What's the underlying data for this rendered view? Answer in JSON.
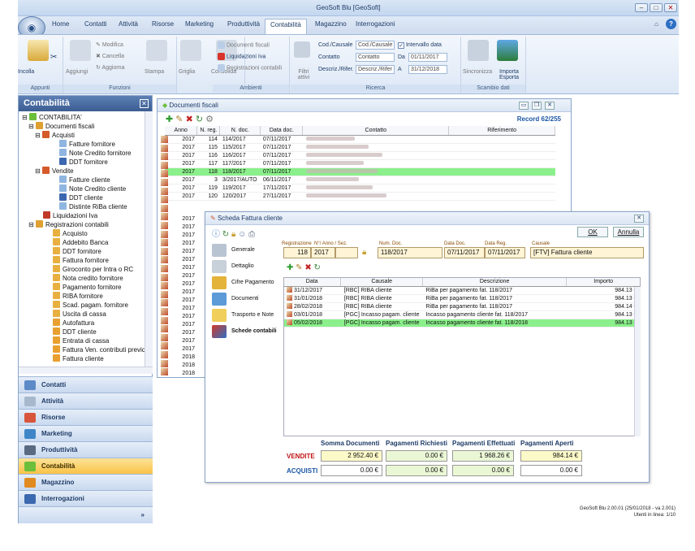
{
  "window": {
    "title": "GeoSoft Blu [GeoSoft]"
  },
  "ribbon": {
    "tabs": [
      "Home",
      "Contatti",
      "Attività",
      "Risorse",
      "Marketing",
      "Produttività",
      "Contabilità",
      "Magazzino",
      "Interrogazioni"
    ],
    "active_tab": "Contabilità",
    "groups": [
      "Appunti",
      "Funzioni",
      "Ambienti",
      "Ricerca",
      "Scambio dati"
    ],
    "buttons": {
      "incolla": "Incolla",
      "aggiungi": "Aggiungi",
      "modifica": "Modifica",
      "cancella": "Cancella",
      "aggiorna": "Aggiorna",
      "stampa": "Stampa",
      "griglia": "Griglia",
      "consolida": "Consolida",
      "documenti_fiscali": "Documenti fiscali",
      "liquidazioni_iva": "Liquidazioni Iva",
      "registrazioni_contabili": "Registrazioni contabili",
      "filtri_attivi": "Filtri attivi",
      "sincronizza": "Sincronizza",
      "importa_esporta": "Importa Esporta"
    },
    "search": {
      "cod_causale_label": "Cod./Causale",
      "cod_causale_value": "Cod./Causale",
      "contatto_label": "Contatto",
      "contatto_value": "Contatto",
      "descriz_label": "Descriz./Rifer.",
      "descriz_value": "Descriz./Rifer",
      "intervallo_label": "Intervallo data",
      "da_label": "Da",
      "da_value": "01/11/2017",
      "a_label": "A",
      "a_value": "31/12/2018"
    }
  },
  "left_panel": {
    "title": "Contabilità",
    "tree": [
      "CONTABILITA'",
      "Documenti fiscali",
      "Acquisti",
      "Fatture fornitore",
      "Note Credito fornitore",
      "DDT fornitore",
      "Vendite",
      "Fatture cliente",
      "Note Credito cliente",
      "DDT cliente",
      "Distinte RiBa cliente",
      "Liquidazioni Iva",
      "Registrazioni contabili",
      "Acquisto",
      "Addebito Banca",
      "DDT fornitore",
      "Fattura fornitore",
      "Giroconto per Intra o RC",
      "Nota credito fornitore",
      "Pagamento fornitore",
      "RIBA fornitore",
      "Scad. pagam. fornitore",
      "Uscita di cassa",
      "Autofattura",
      "DDT cliente",
      "Entrata di cassa",
      "Fattura Ven. contributi previd",
      "Fattura cliente"
    ],
    "nav": [
      "Contatti",
      "Attività",
      "Risorse",
      "Marketing",
      "Produttività",
      "Contabilità",
      "Magazzino",
      "Interrogazioni"
    ],
    "active_nav": "Contabilità"
  },
  "docs_window": {
    "title": "Documenti fiscali",
    "record": "Record 62/255",
    "columns": [
      "Anno",
      "N. reg.",
      "N. doc.",
      "Data doc.",
      "Contatto",
      "Riferimento"
    ],
    "rows": [
      [
        "2017",
        "114",
        "114/2017",
        "07/11/2017"
      ],
      [
        "2017",
        "115",
        "115/2017",
        "07/11/2017"
      ],
      [
        "2017",
        "116",
        "116/2017",
        "07/11/2017"
      ],
      [
        "2017",
        "117",
        "117/2017",
        "07/11/2017"
      ],
      [
        "2017",
        "118",
        "118/2017",
        "07/11/2017"
      ],
      [
        "2017",
        "3",
        "3/2017/AUTO",
        "06/11/2017"
      ],
      [
        "2017",
        "119",
        "119/2017",
        "17/11/2017"
      ],
      [
        "2017",
        "120",
        "120/2017",
        "27/11/2017"
      ]
    ],
    "years_below": [
      "2017",
      "2017",
      "2017",
      "2017",
      "2017",
      "2017",
      "2017",
      "2017",
      "2017",
      "2017",
      "2017",
      "2017",
      "2017",
      "2017",
      "2017",
      "2017",
      "2017",
      "2018",
      "2018",
      "2018"
    ],
    "selected_index": 4
  },
  "scheda": {
    "title": "Scheda Fattura cliente",
    "ok": "OK",
    "annulla": "Annulla",
    "labels": {
      "registrazione": "Registrazione",
      "n_anno_sez": "N°/ Anno / Sez.",
      "num_doc": "Num. Doc.",
      "data_doc": "Data Doc.",
      "data_reg": "Data Reg.",
      "causale": "Causale"
    },
    "values": {
      "n": "118",
      "anno": "2017",
      "num_doc": "118/2017",
      "data_doc": "07/11/2017",
      "data_reg": "07/11/2017",
      "causale": "[FTV] Fattura cliente"
    },
    "side": [
      "Generale",
      "Dettaglio",
      "Cifre Pagamento",
      "Documenti",
      "Trasporto e Note",
      "Schede contabili"
    ],
    "active_side": "Schede contabili",
    "columns": [
      "Data",
      "Causale",
      "Descrizione",
      "Importo"
    ],
    "rows": [
      [
        "31/12/2017",
        "[RBC] RIBA cliente",
        "RiBa per pagamento fat. 118/2017",
        "984.13 €"
      ],
      [
        "31/01/2018",
        "[RBC] RIBA cliente",
        "RiBa per pagamento fat. 118/2017",
        "984.13 €"
      ],
      [
        "28/02/2018",
        "[RBC] RIBA cliente",
        "RiBa per pagamento fat. 118/2017",
        "984.14 €"
      ],
      [
        "03/01/2018",
        "[PGC] Incasso pagam. cliente",
        "Incasso pagamento cliente fat. 118/2017",
        "984.13 €"
      ],
      [
        "05/02/2018",
        "[PGC] Incasso pagam. cliente",
        "Incasso pagamento cliente fat. 118/2018",
        "984.13 €"
      ]
    ],
    "selected_index": 4,
    "summary": {
      "headers": [
        "Somma Documenti",
        "Pagamenti Richiesti",
        "Pagamenti Effettuati",
        "Pagamenti Aperti"
      ],
      "vendite_label": "VENDITE",
      "acquisti_label": "ACQUISTI",
      "vendite": [
        "2 952.40 €",
        "0.00 €",
        "1 968.26 €",
        "984.14 €"
      ],
      "acquisti": [
        "0.00 €",
        "0.00 €",
        "0.00 €",
        "0.00 €"
      ]
    }
  },
  "status": {
    "version": "GeoSoft Blu 2.00.01 (25/01/2018 - va 2.001)",
    "users": "Utenti in linea: 1/10"
  },
  "colors": {
    "selected_row": "#8bf08b",
    "active_nav": "#f9c346",
    "header_blue": "#3c5d92"
  }
}
